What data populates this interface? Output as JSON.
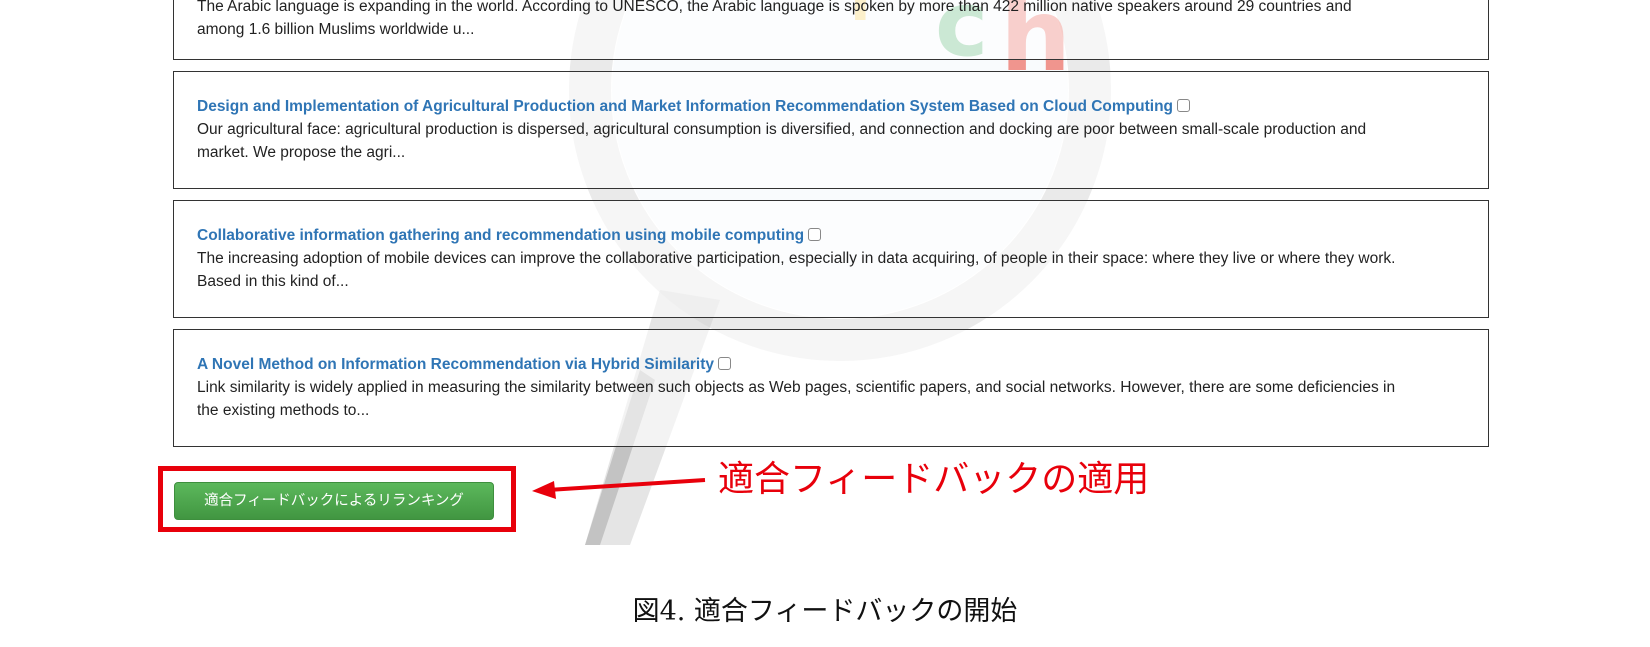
{
  "results": [
    {
      "title": "",
      "snippet_line1": "The Arabic language is expanding in the world. According to UNESCO, the Arabic language is spoken by more than 422 million native speakers around 29 countries and",
      "snippet_line2": "among 1.6 billion Muslims worldwide u..."
    },
    {
      "title": "Design and Implementation of Agricultural Production and Market Information Recommendation System Based on Cloud Computing",
      "snippet_line1": "Our agricultural face: agricultural production is dispersed, agricultural consumption is diversified, and connection and docking are poor between small-scale production and",
      "snippet_line2": "market. We propose the agri..."
    },
    {
      "title": "Collaborative information gathering and recommendation using mobile computing",
      "snippet_line1": "The increasing adoption of mobile devices can improve the collaborative participation, especially in data acquiring, of people in their space: where they live or where they work.",
      "snippet_line2": "Based in this kind of..."
    },
    {
      "title": "A Novel Method on Information Recommendation via Hybrid Similarity",
      "snippet_line1": "Link similarity is widely applied in measuring the similarity between such objects as Web pages, scientific papers, and social networks. However, there are some deficiencies in",
      "snippet_line2": "the existing methods to..."
    }
  ],
  "rerank_button": {
    "label": "適合フィードバックによるリランキング"
  },
  "annotation": {
    "label": "適合フィードバックの適用",
    "color": "#e8000b"
  },
  "caption": "図4. 適合フィードバックの開始",
  "colors": {
    "title_link": "#2f75b5",
    "button_green": "#5cb85c",
    "highlight_red": "#e8000b"
  }
}
